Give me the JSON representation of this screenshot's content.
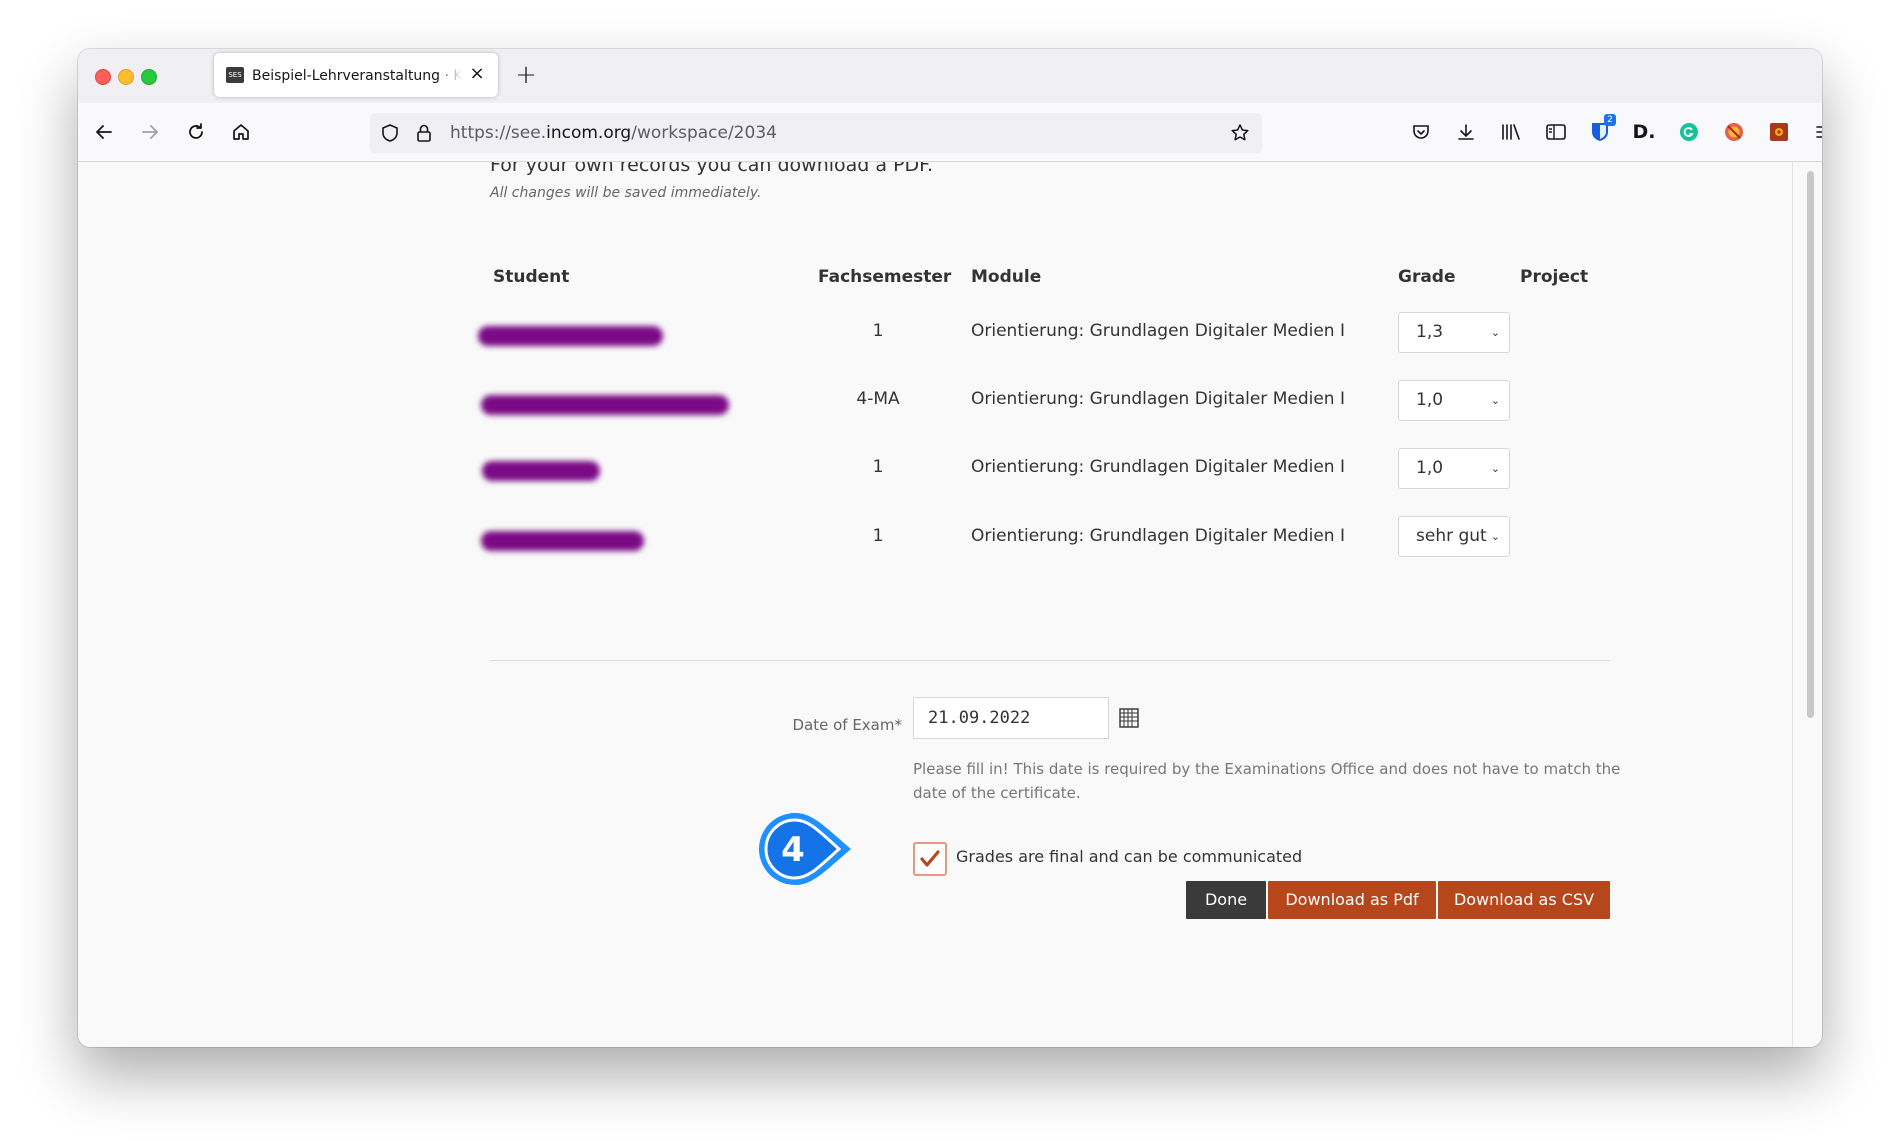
{
  "browser": {
    "tab": {
      "title": "Beispiel-Lehrveranstaltung · KHI",
      "favicon_text": "SES"
    },
    "url": {
      "prefix": "https://see.",
      "host": "incom.org",
      "path": "/workspace/2034"
    },
    "extensions": [
      {
        "icon": "pocket-icon"
      },
      {
        "icon": "download-icon"
      },
      {
        "icon": "library-icon"
      },
      {
        "icon": "reader-view-icon"
      },
      {
        "icon": "bitwarden-icon",
        "badge": "2"
      },
      {
        "icon": "dlogo-icon",
        "text": "D."
      },
      {
        "icon": "grammarly-icon"
      },
      {
        "icon": "blocker-icon"
      },
      {
        "icon": "gear-extension-icon"
      }
    ]
  },
  "page": {
    "clipped_line": "For your own records you can download a PDF.",
    "autosave_note": "All changes will be saved immediately.",
    "table": {
      "headers": {
        "student": "Student",
        "semester": "Fachsemester",
        "module": "Module",
        "grade": "Grade",
        "project": "Project"
      },
      "rows": [
        {
          "semester": "1",
          "module": "Orientierung: Grundlagen Digitaler Medien I",
          "grade": "1,3"
        },
        {
          "semester": "4-MA",
          "module": "Orientierung: Grundlagen Digitaler Medien I",
          "grade": "1,0"
        },
        {
          "semester": "1",
          "module": "Orientierung: Grundlagen Digitaler Medien I",
          "grade": "1,0"
        },
        {
          "semester": "1",
          "module": "Orientierung: Grundlagen Digitaler Medien I",
          "grade": "sehr gut"
        }
      ]
    },
    "date_of_exam": {
      "label": "Date of Exam*",
      "value": "21.09.2022",
      "hint": "Please fill in! This date is required by the Examinations Office and does not have to match the date of the certificate."
    },
    "final_checkbox": {
      "label": "Grades are final and can be communicated",
      "checked": true
    },
    "step_marker": "4",
    "buttons": {
      "done": "Done",
      "pdf": "Download as Pdf",
      "csv": "Download as CSV"
    }
  },
  "colors": {
    "accent": "#b6471d",
    "done": "#3a3a3a",
    "step": "#1e90ff",
    "redaction": "#7a0a85"
  }
}
